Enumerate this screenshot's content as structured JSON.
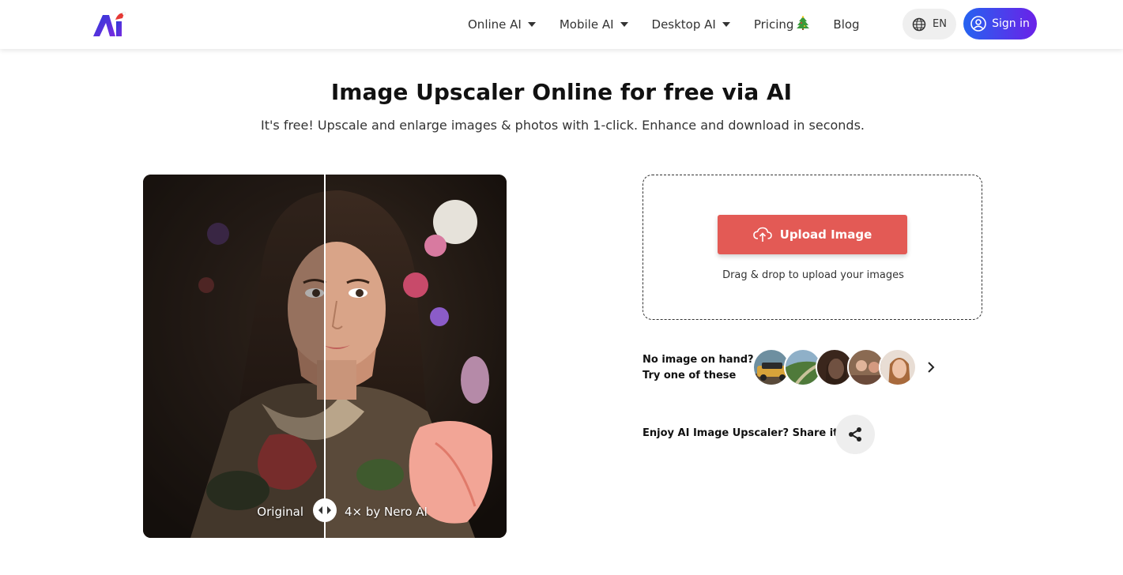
{
  "brand": {
    "logo_text": "Ai"
  },
  "nav": {
    "items": [
      {
        "label": "Online AI",
        "has_dropdown": true
      },
      {
        "label": "Mobile AI",
        "has_dropdown": true
      },
      {
        "label": "Desktop AI",
        "has_dropdown": true
      },
      {
        "label": "Pricing",
        "has_dropdown": false
      },
      {
        "label": "Blog",
        "has_dropdown": false
      }
    ],
    "language": "EN",
    "signin_label": "Sign in"
  },
  "hero": {
    "title": "Image Upscaler Online for free via AI",
    "subtitle": "It's free! Upscale and enlarge images & photos with 1-click. Enhance and download in seconds."
  },
  "compare": {
    "left_label": "Original",
    "right_label": "4× by Nero AI"
  },
  "upload": {
    "button_label": "Upload Image",
    "hint": "Drag & drop to upload your images"
  },
  "samples": {
    "line1": "No image on hand?",
    "line2": "Try one of these",
    "thumbnails": [
      "car-sample",
      "landscape-sample",
      "girl-portrait-sample",
      "group-photo-sample",
      "woman-portrait-sample"
    ]
  },
  "share": {
    "label": "Enjoy AI Image Upscaler? Share it!"
  },
  "colors": {
    "upload_button": "#e35a55",
    "signin_start": "#2563f0",
    "signin_end": "#6b21e8"
  }
}
